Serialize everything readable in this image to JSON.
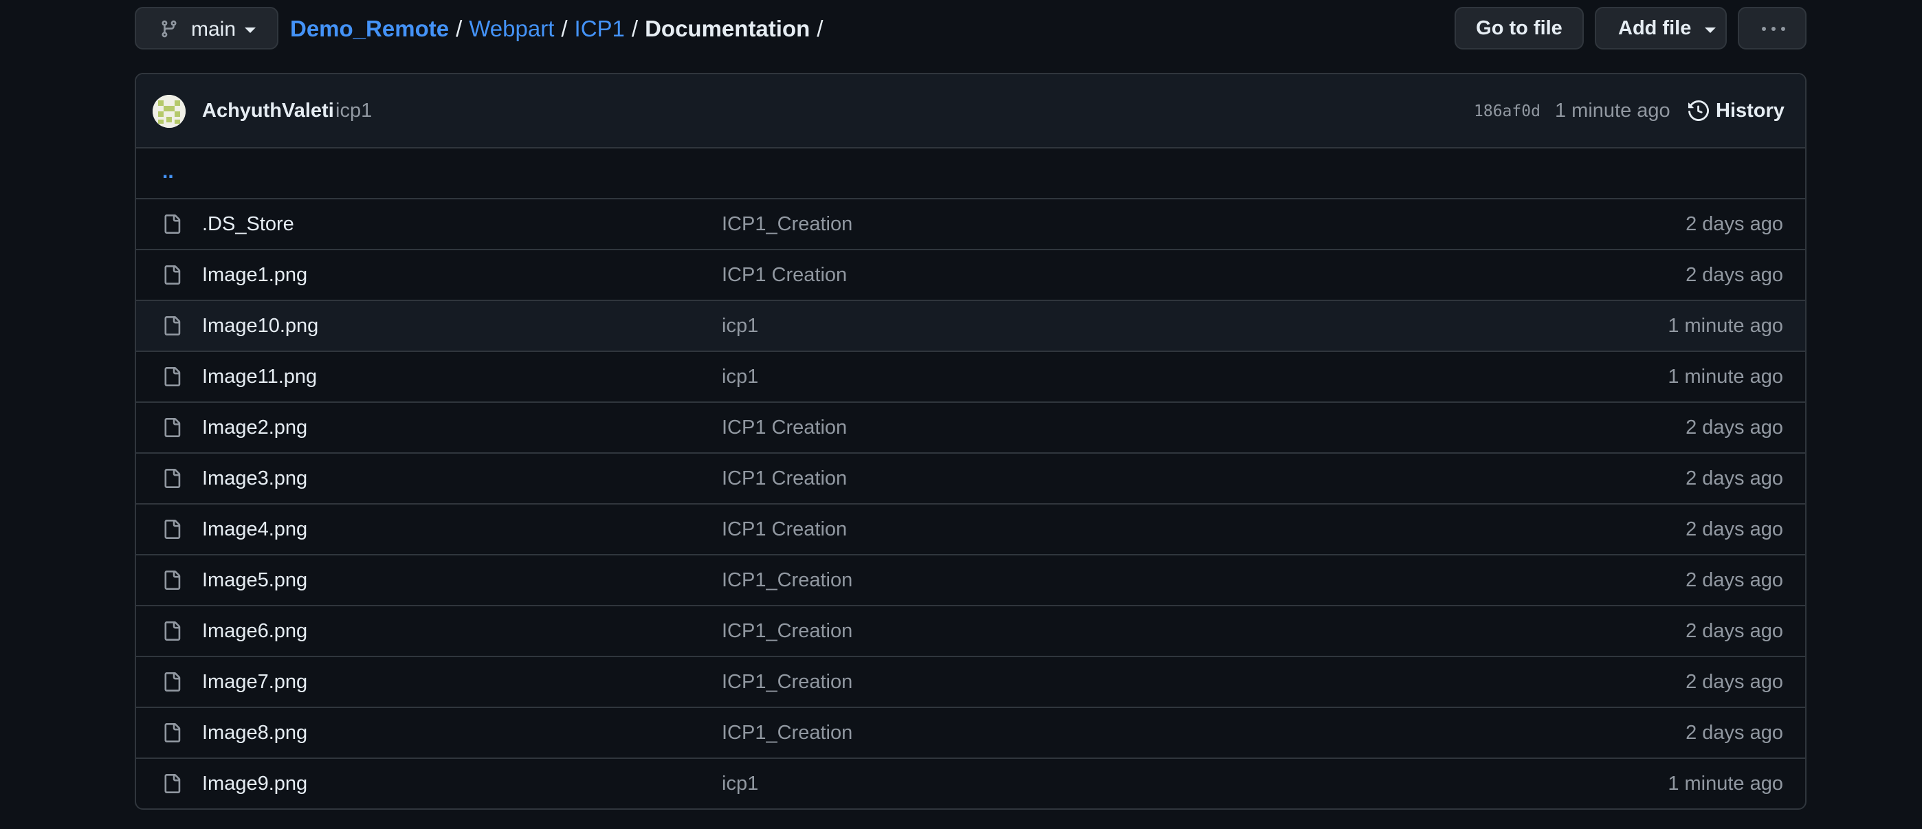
{
  "branch": {
    "icon": "git-branch-icon",
    "name": "main"
  },
  "breadcrumb": {
    "repo": "Demo_Remote",
    "sep": "/",
    "folders": [
      "Webpart",
      "ICP1"
    ],
    "current": "Documentation",
    "trailing_sep": "/"
  },
  "actions": {
    "go_to_file": "Go to file",
    "add_file": "Add file",
    "more_icon": "kebab-horizontal-icon"
  },
  "commit": {
    "author": "AchyuthValeti",
    "message": "icp1",
    "sha": "186af0d",
    "time": "1 minute ago",
    "history_label": "History",
    "history_icon": "history-icon"
  },
  "parent_dir": "..",
  "files": [
    {
      "name": ".DS_Store",
      "commit": "ICP1_Creation",
      "time": "2 days ago"
    },
    {
      "name": "Image1.png",
      "commit": "ICP1 Creation",
      "time": "2 days ago"
    },
    {
      "name": "Image10.png",
      "commit": "icp1",
      "time": "1 minute ago"
    },
    {
      "name": "Image11.png",
      "commit": "icp1",
      "time": "1 minute ago"
    },
    {
      "name": "Image2.png",
      "commit": "ICP1 Creation",
      "time": "2 days ago"
    },
    {
      "name": "Image3.png",
      "commit": "ICP1 Creation",
      "time": "2 days ago"
    },
    {
      "name": "Image4.png",
      "commit": "ICP1 Creation",
      "time": "2 days ago"
    },
    {
      "name": "Image5.png",
      "commit": "ICP1_Creation",
      "time": "2 days ago"
    },
    {
      "name": "Image6.png",
      "commit": "ICP1_Creation",
      "time": "2 days ago"
    },
    {
      "name": "Image7.png",
      "commit": "ICP1_Creation",
      "time": "2 days ago"
    },
    {
      "name": "Image8.png",
      "commit": "ICP1_Creation",
      "time": "2 days ago"
    },
    {
      "name": "Image9.png",
      "commit": "icp1",
      "time": "1 minute ago"
    }
  ],
  "colors": {
    "background": "#0d1117",
    "link": "#4493f8",
    "text": "#e6edf3",
    "muted": "#9198a1",
    "border": "#30363d"
  }
}
